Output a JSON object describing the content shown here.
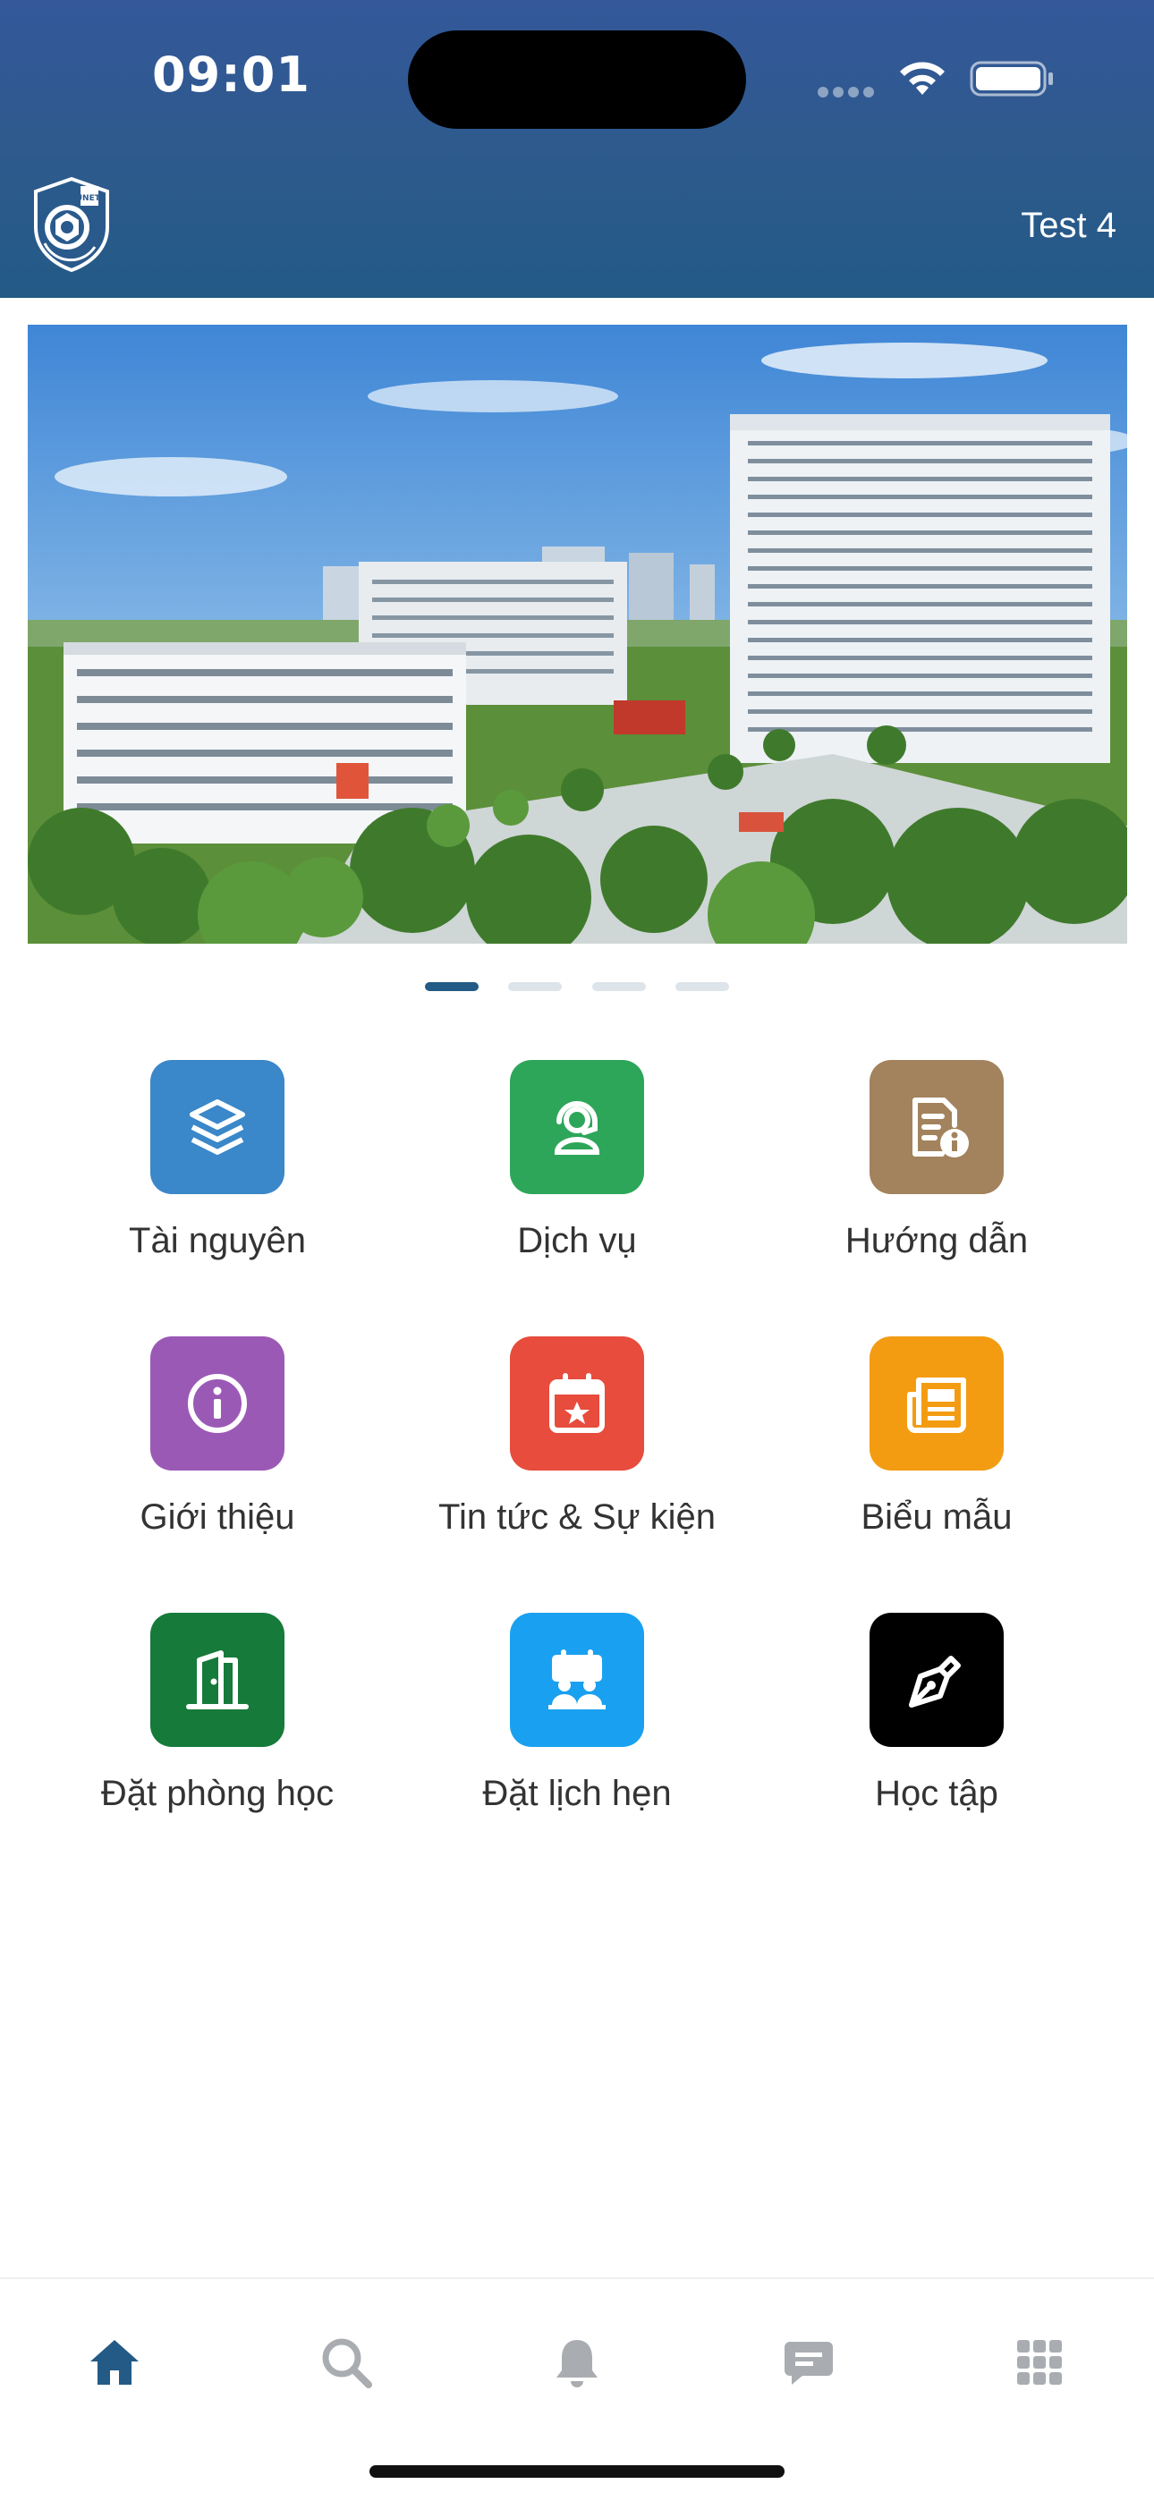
{
  "status_bar": {
    "time": "09:01"
  },
  "header": {
    "user_name": "Test 4",
    "logo_text": "UNETI"
  },
  "banner": {
    "slide_count": 4,
    "active_index": 0
  },
  "menu": [
    {
      "label": "Tài nguyên",
      "icon": "layers-icon",
      "color": "#3a87c9"
    },
    {
      "label": "Dịch vụ",
      "icon": "support-agent-icon",
      "color": "#2ea65a"
    },
    {
      "label": "Hướng dẫn",
      "icon": "document-info-icon",
      "color": "#a2835d"
    },
    {
      "label": "Giới thiệu",
      "icon": "info-circle-icon",
      "color": "#9b59b6"
    },
    {
      "label": "Tin tức & Sự kiện",
      "icon": "calendar-star-icon",
      "color": "#e74c3c"
    },
    {
      "label": "Biểu mẫu",
      "icon": "newspaper-icon",
      "color": "#f39c12"
    },
    {
      "label": "Đặt phòng học",
      "icon": "door-icon",
      "color": "#167a3a"
    },
    {
      "label": "Đặt lịch hẹn",
      "icon": "meeting-icon",
      "color": "#1aa0f0"
    },
    {
      "label": "Học tập",
      "icon": "pen-nib-icon",
      "color": "#000000"
    }
  ],
  "bottom_nav": [
    {
      "name": "home",
      "icon": "home-icon",
      "active": true
    },
    {
      "name": "search",
      "icon": "search-icon",
      "active": false
    },
    {
      "name": "notifications",
      "icon": "bell-icon",
      "active": false
    },
    {
      "name": "messages",
      "icon": "chat-icon",
      "active": false
    },
    {
      "name": "apps",
      "icon": "grid-icon",
      "active": false
    }
  ],
  "colors": {
    "header": "#2d5a8c",
    "nav_active": "#235a86",
    "nav_inactive": "#a9adb1"
  }
}
